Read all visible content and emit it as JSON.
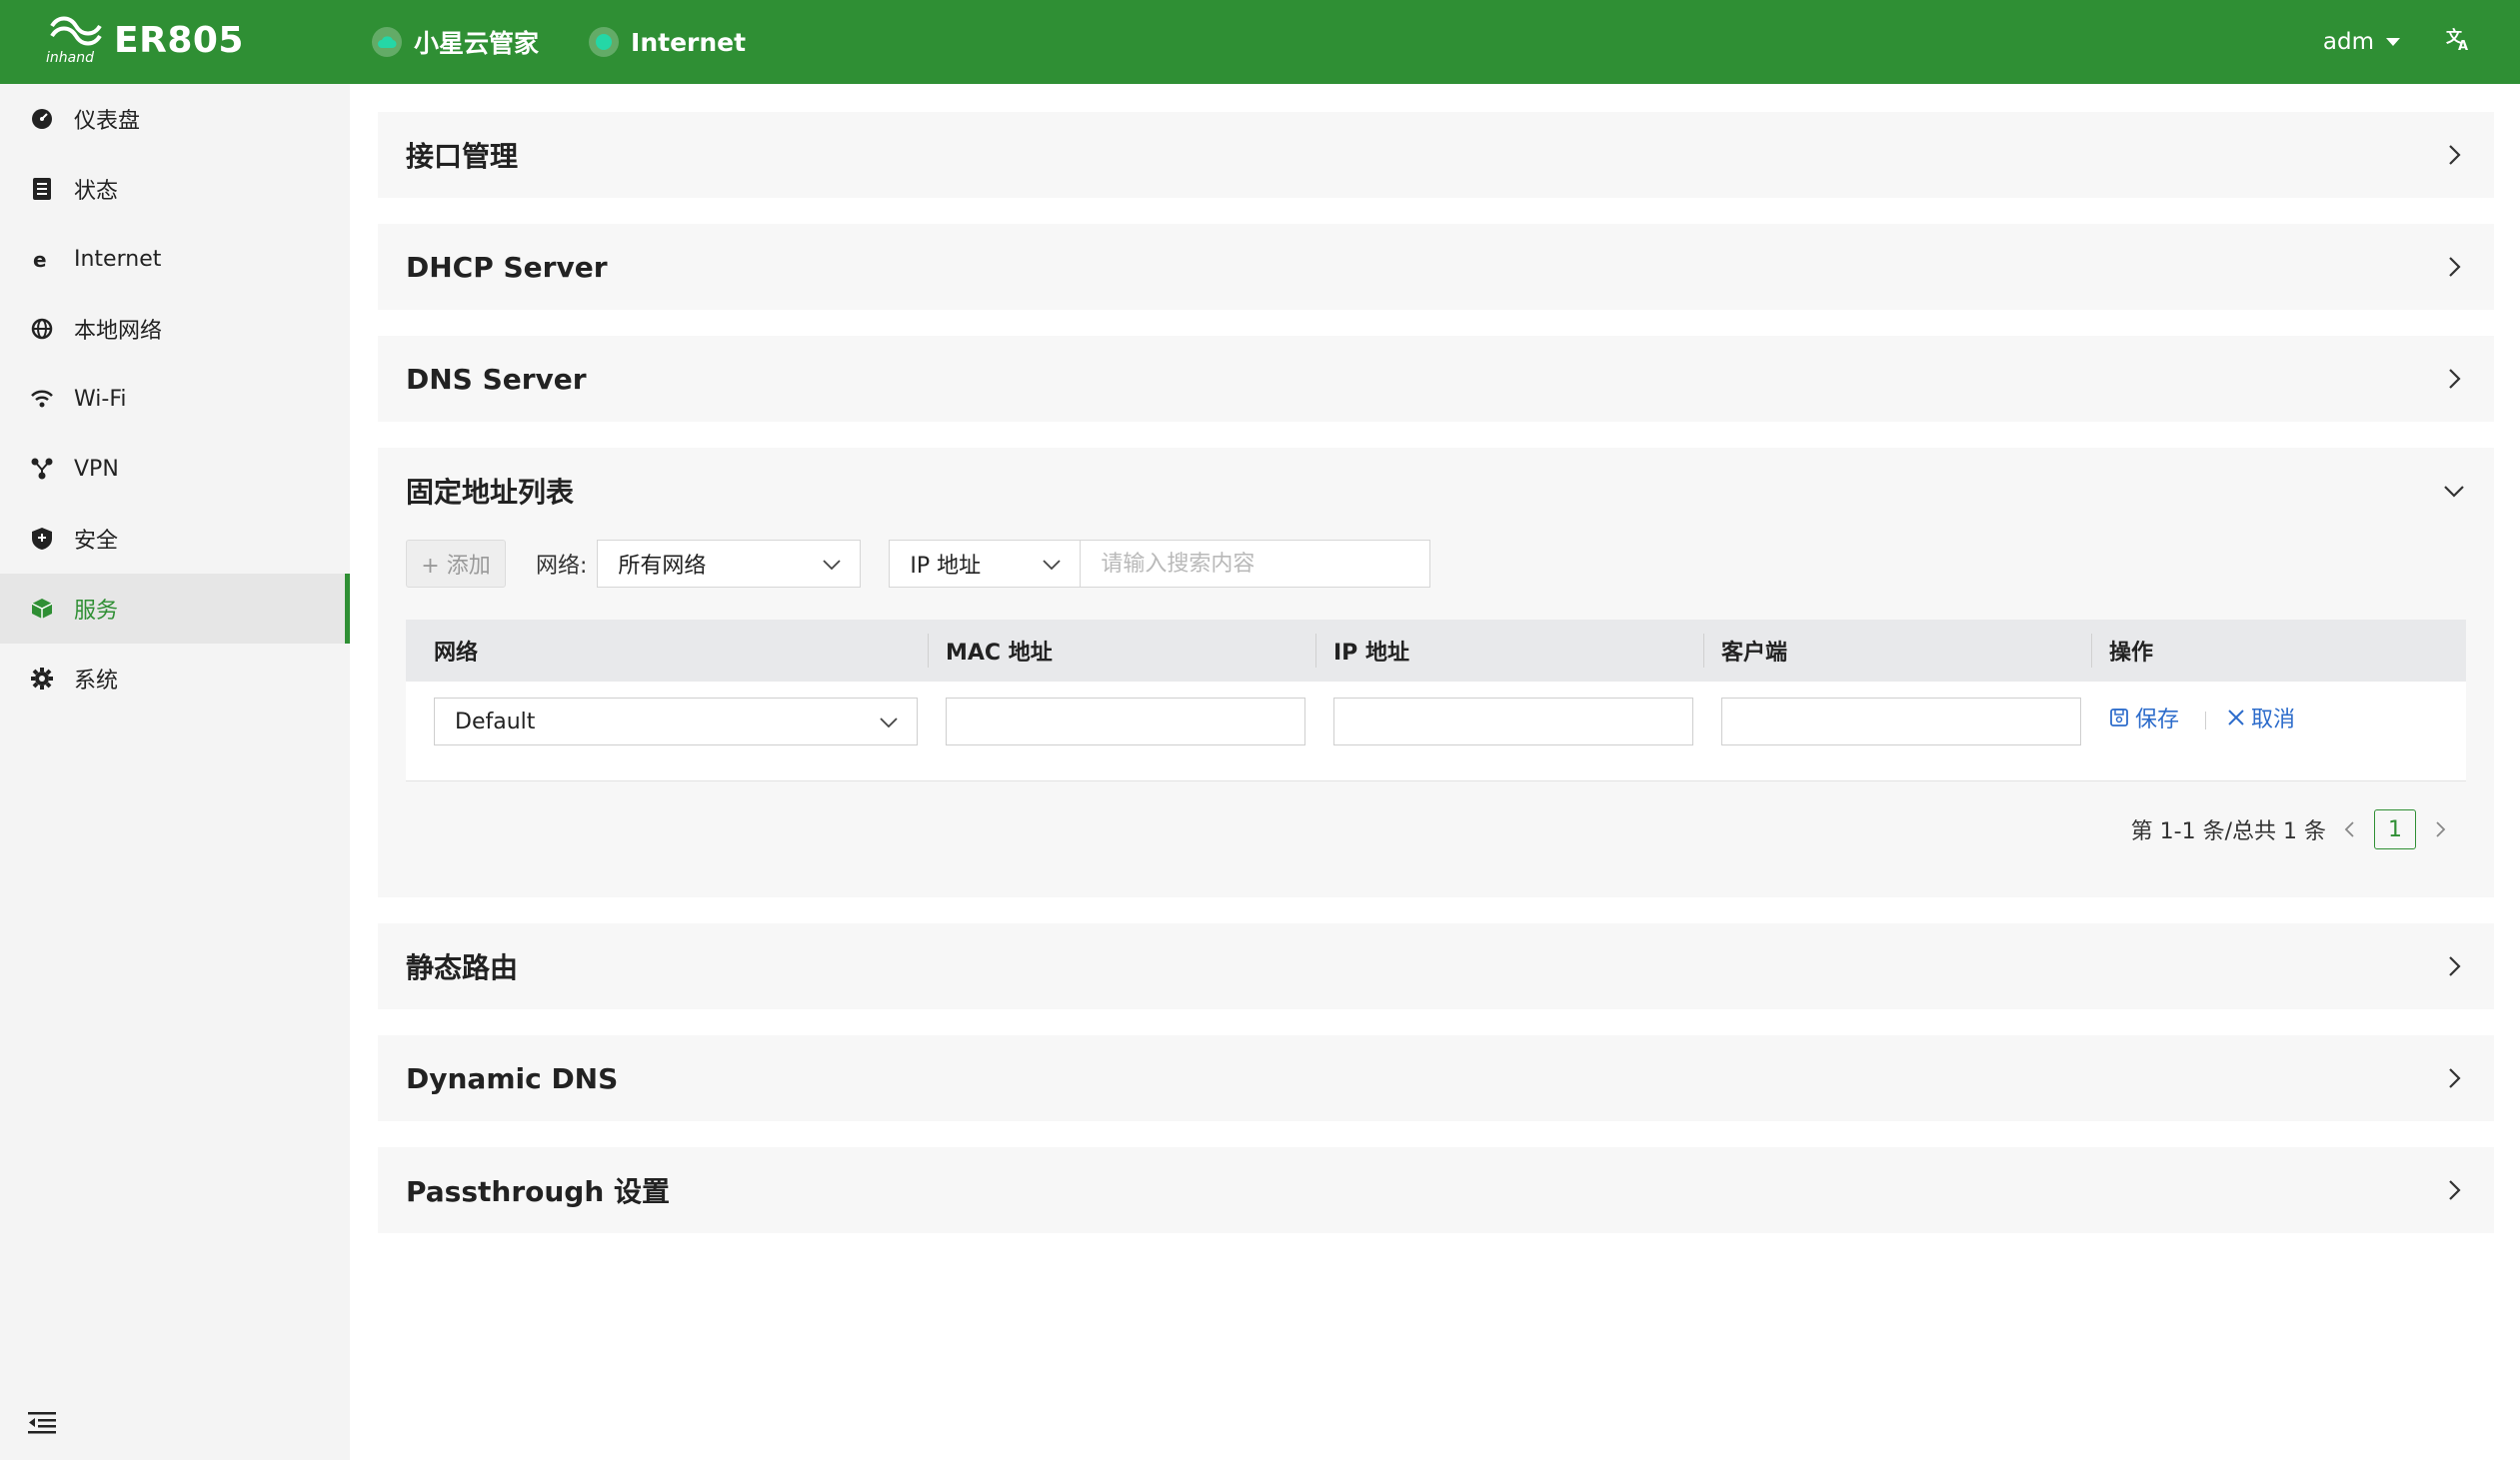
{
  "header": {
    "product": "ER805",
    "logo_text": "inhand",
    "nav": [
      {
        "label": "小星云管家",
        "icon": "cloud-icon"
      },
      {
        "label": "Internet",
        "icon": "status-dot-icon"
      }
    ],
    "user": "adm",
    "language_icon": "translate-icon"
  },
  "sidebar": {
    "items": [
      {
        "label": "仪表盘",
        "icon": "dashboard-icon"
      },
      {
        "label": "状态",
        "icon": "status-icon"
      },
      {
        "label": "Internet",
        "icon": "internet-icon"
      },
      {
        "label": "本地网络",
        "icon": "globe-icon"
      },
      {
        "label": "Wi-Fi",
        "icon": "wifi-icon"
      },
      {
        "label": "VPN",
        "icon": "vpn-icon"
      },
      {
        "label": "安全",
        "icon": "shield-icon"
      },
      {
        "label": "服务",
        "icon": "cube-icon",
        "active": true
      },
      {
        "label": "系统",
        "icon": "gear-icon"
      }
    ],
    "collapse_icon": "menu-collapse-icon"
  },
  "panels": {
    "interface": "接口管理",
    "dhcp": "DHCP Server",
    "dns": "DNS Server",
    "static_addr": "固定地址列表",
    "static_route": "静态路由",
    "ddns": "Dynamic DNS",
    "passthrough": "Passthrough 设置"
  },
  "static_list": {
    "add_label": "+ 添加",
    "network_label": "网络:",
    "network_value": "所有网络",
    "search_field": "IP 地址",
    "search_placeholder": "请输入搜索内容",
    "columns": [
      "网络",
      "MAC 地址",
      "IP 地址",
      "客户端",
      "操作"
    ],
    "row": {
      "network": "Default",
      "mac": "",
      "ip": "",
      "client": "",
      "save": "保存",
      "cancel": "取消"
    },
    "pager": {
      "summary": "第 1-1 条/总共 1 条",
      "current_page": "1"
    }
  },
  "colors": {
    "brand": "#2f8f34",
    "link": "#2d6ccb",
    "accent_dot": "#24d7a6"
  }
}
